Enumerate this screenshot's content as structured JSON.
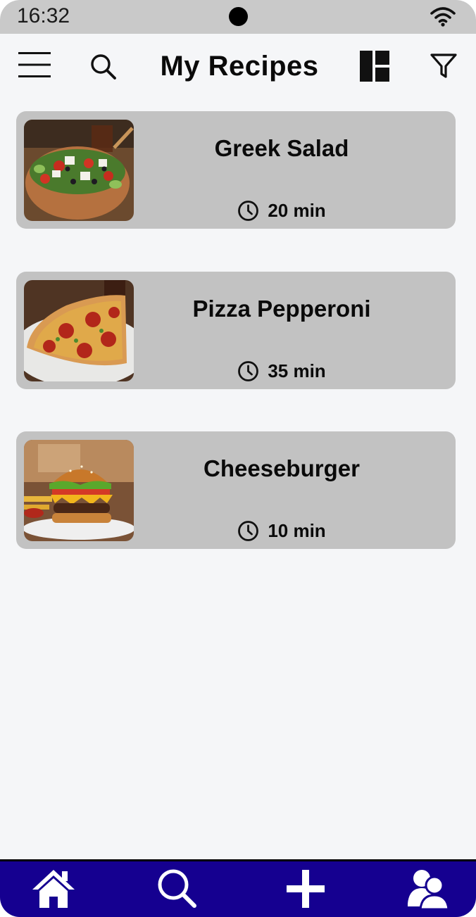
{
  "status_bar": {
    "time": "16:32"
  },
  "header": {
    "title": "My Recipes",
    "icons": {
      "menu": "hamburger-menu-icon",
      "search": "search-icon",
      "layout": "grid-layout-icon",
      "filter": "filter-icon"
    }
  },
  "recipes": [
    {
      "name": "Greek Salad",
      "time": "20 min",
      "image": "greek-salad-photo"
    },
    {
      "name": "Pizza Pepperoni",
      "time": "35 min",
      "image": "pizza-slice-photo"
    },
    {
      "name": "Cheeseburger",
      "time": "10 min",
      "image": "cheeseburger-photo"
    }
  ],
  "bottom_nav": {
    "items": [
      "home-icon",
      "search-icon",
      "add-icon",
      "profile-icon"
    ]
  },
  "colors": {
    "background": "#f5f6f8",
    "status_bar": "#c9c9c9",
    "card": "#c2c2c2",
    "bottom_nav": "#150090",
    "text": "#0a0a0a"
  }
}
